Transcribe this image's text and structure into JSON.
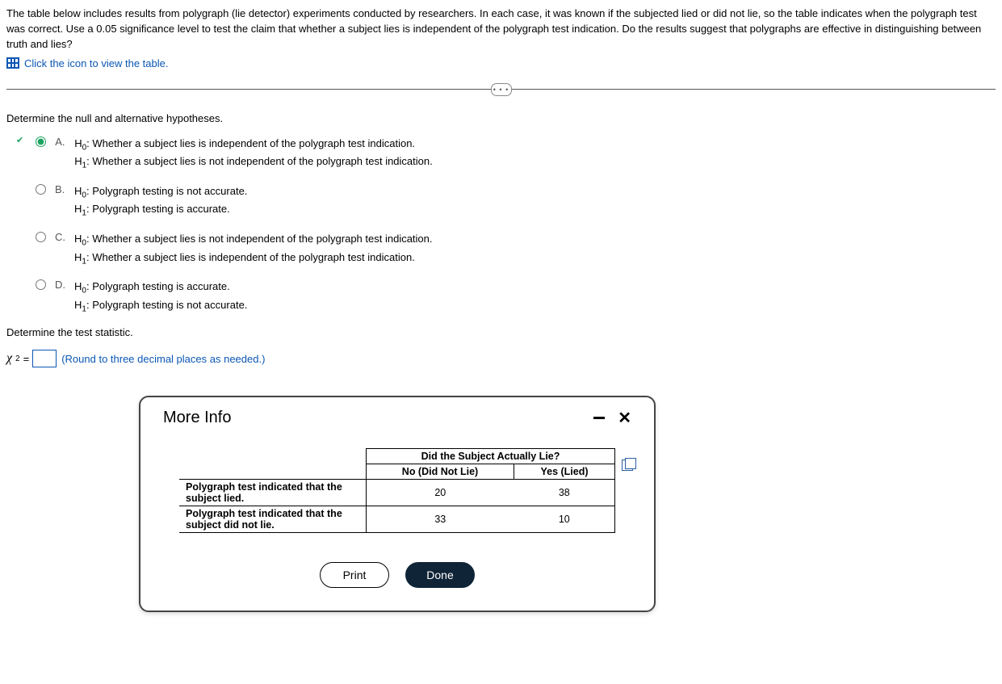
{
  "question": {
    "text": "The table below includes results from polygraph (lie detector) experiments conducted by researchers. In each case, it was known if the subjected lied or did not lie, so the table indicates when the polygraph test was correct. Use a 0.05 significance level to test the claim that whether a subject lies is independent of the polygraph test indication. Do the results suggest that polygraphs are effective in distinguishing between truth and lies?",
    "table_link_label": "Click the icon to view the table."
  },
  "hypotheses": {
    "instruction": "Determine the null and alternative hypotheses.",
    "options": {
      "A": {
        "h0": "Whether a subject lies is independent of the polygraph test indication.",
        "h1": "Whether a subject lies is not independent of the polygraph test indication."
      },
      "B": {
        "h0": "Polygraph testing is not accurate.",
        "h1": "Polygraph testing is accurate."
      },
      "C": {
        "h0": "Whether a subject lies is not independent of the polygraph test indication.",
        "h1": "Whether a subject lies is independent of the polygraph test indication."
      },
      "D": {
        "h0": "Polygraph testing is accurate.",
        "h1": "Polygraph testing is not accurate."
      }
    },
    "selected": "A",
    "letters": {
      "A": "A.",
      "B": "B.",
      "C": "C.",
      "D": "D."
    },
    "h0_label": "H",
    "h0_sub": "0",
    "h1_label": "H",
    "h1_sub": "1",
    "colon": ": "
  },
  "statistic": {
    "instruction": "Determine the test statistic.",
    "symbol": "χ",
    "sup": "2",
    "equals": " = ",
    "value": "",
    "hint": "(Round to three decimal places as needed.)"
  },
  "modal": {
    "title": "More Info",
    "table": {
      "top_header": "Did the Subject Actually Lie?",
      "col1": "No (Did Not Lie)",
      "col2": "Yes (Lied)",
      "rows": [
        {
          "label": "Polygraph test indicated that the subject lied.",
          "c1": "20",
          "c2": "38"
        },
        {
          "label": "Polygraph test indicated that the subject did not lie.",
          "c1": "33",
          "c2": "10"
        }
      ]
    },
    "buttons": {
      "print": "Print",
      "done": "Done"
    }
  },
  "more_dots": "• • •"
}
